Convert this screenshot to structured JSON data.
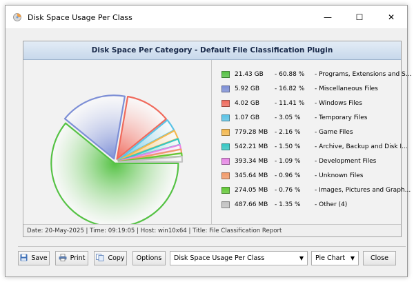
{
  "window": {
    "title": "Disk Space Usage Per Class"
  },
  "controls": {
    "minimize": "—",
    "maximize": "☐",
    "close": "✕"
  },
  "panel": {
    "title": "Disk Space Per Category - Default File Classification Plugin"
  },
  "chart_data": {
    "type": "pie",
    "categories": [
      "Programs, Extensions and S...",
      "Miscellaneous Files",
      "Windows Files",
      "Temporary Files",
      "Game Files",
      "Archive, Backup and Disk I...",
      "Development Files",
      "Unknown Files",
      "Images, Pictures and Graph...",
      "Other (4)"
    ],
    "values": [
      60.88,
      16.82,
      11.41,
      3.05,
      2.16,
      1.5,
      1.09,
      0.96,
      0.76,
      1.35
    ],
    "sizes": [
      "21.43 GB",
      "5.92 GB",
      "4.02 GB",
      "1.07 GB",
      "779.28 MB",
      "542.21 MB",
      "393.34 MB",
      "345.64 MB",
      "274.05 MB",
      "487.66 MB"
    ],
    "percent_labels": [
      "60.88 %",
      "16.82 %",
      "11.41 %",
      "3.05 %",
      "2.16 %",
      "1.50 %",
      "1.09 %",
      "0.96 %",
      "0.76 %",
      "1.35 %"
    ],
    "colors": [
      "#55c244",
      "#7d8fd6",
      "#f06a5c",
      "#5bc3e6",
      "#f4b84d",
      "#35c7c3",
      "#e787e6",
      "#f29a6a",
      "#62c935",
      "#c2c2c2"
    ],
    "exploded": true
  },
  "status": {
    "text": "Date: 20-May-2025 | Time: 09:19:05 | Host: win10x64 | Title: File Classification Report"
  },
  "toolbar": {
    "save_label": "Save",
    "print_label": "Print",
    "copy_label": "Copy",
    "options_label": "Options",
    "report_select_value": "Disk Space Usage Per Class",
    "chart_type_value": "Pie Chart",
    "close_label": "Close"
  }
}
